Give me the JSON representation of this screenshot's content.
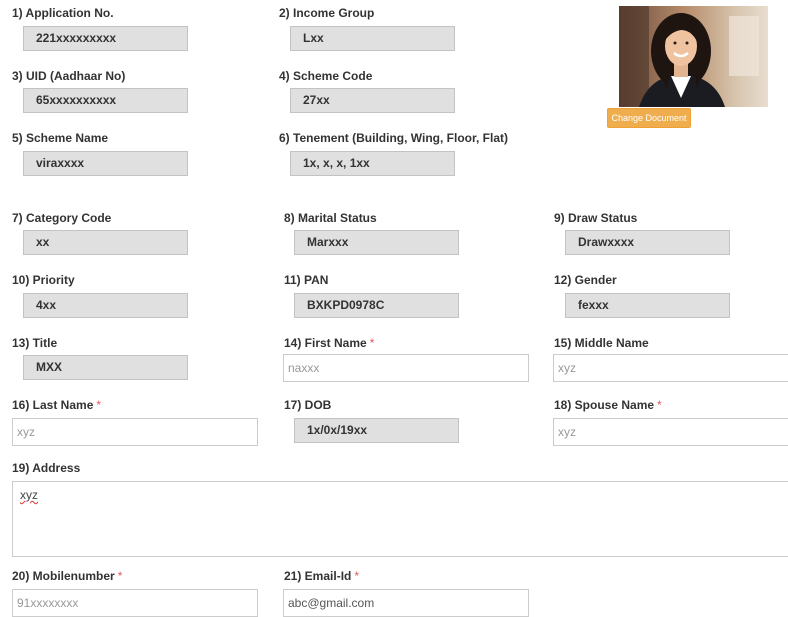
{
  "photo": {
    "change_button": "Change Document"
  },
  "fields": {
    "application_no": {
      "label": "1) Application No.",
      "value": "221xxxxxxxxx"
    },
    "income_group": {
      "label": "2) Income Group",
      "value": "Lxx"
    },
    "uid": {
      "label": "3) UID (Aadhaar No)",
      "value": "65xxxxxxxxxx"
    },
    "scheme_code": {
      "label": "4) Scheme Code",
      "value": "27xx"
    },
    "scheme_name": {
      "label": "5) Scheme Name",
      "value": "viraxxxx"
    },
    "tenement": {
      "label": "6) Tenement (Building, Wing, Floor, Flat)",
      "value": "1x, x, x, 1xx"
    },
    "category_code": {
      "label": "7) Category Code",
      "value": "xx"
    },
    "marital_status": {
      "label": "8) Marital Status",
      "value": "Marxxx"
    },
    "draw_status": {
      "label": "9) Draw Status",
      "value": "Drawxxxx"
    },
    "priority": {
      "label": "10) Priority",
      "value": "4xx"
    },
    "pan": {
      "label": "11) PAN",
      "value": "BXKPD0978C"
    },
    "gender": {
      "label": "12) Gender",
      "value": "fexxx"
    },
    "title": {
      "label": "13) Title",
      "value": "MXX"
    },
    "first_name": {
      "label": "14) First Name",
      "required": "*",
      "placeholder": "naxxx"
    },
    "middle_name": {
      "label": "15) Middle Name",
      "placeholder": "xyz"
    },
    "last_name": {
      "label": "16) Last Name",
      "required": "*",
      "placeholder": "xyz"
    },
    "dob": {
      "label": "17) DOB",
      "value": "1x/0x/19xx"
    },
    "spouse_name": {
      "label": "18) Spouse Name",
      "required": "*",
      "placeholder": "xyz"
    },
    "address": {
      "label": "19) Address",
      "value": "xyz"
    },
    "mobile": {
      "label": "20) Mobilenumber",
      "required": "*",
      "placeholder": "91xxxxxxxx"
    },
    "email": {
      "label": "21) Email-Id",
      "required": "*",
      "value": "abc@gmail.com"
    }
  },
  "colors": {
    "readonly_bg": "#e0e0e0",
    "required_mark": "#e35a5a",
    "button_bg": "#f0ad4e"
  }
}
